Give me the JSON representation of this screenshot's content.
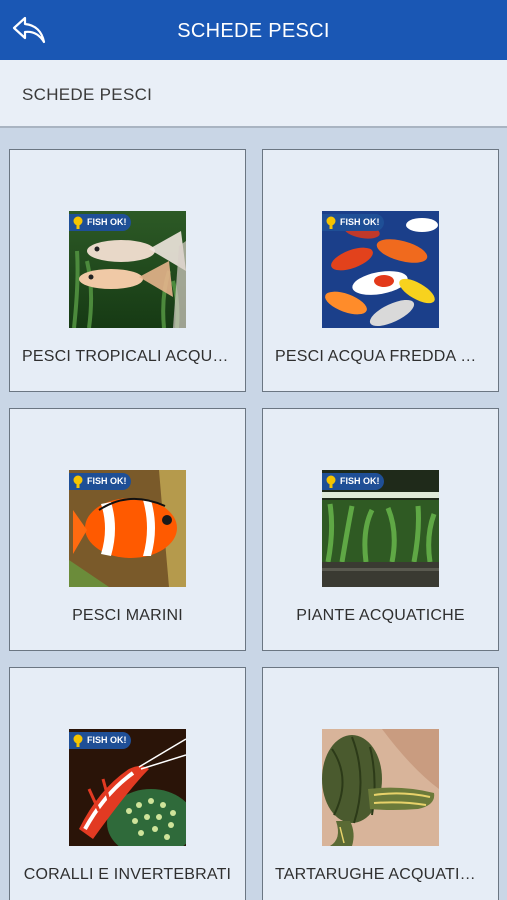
{
  "header": {
    "title": "SCHEDE PESCI",
    "back_icon": "back-arrow-icon",
    "background": "#1a57b4"
  },
  "subheader": {
    "title": "SCHEDE PESCI"
  },
  "badge_text": "FISH OK!",
  "categories": [
    {
      "label": "PESCI TROPICALI ACQUA DOLCE",
      "image": "tropical-fish-photo",
      "badge": true
    },
    {
      "label": "PESCI ACQUA FREDDA E LAGHETTO",
      "image": "koi-carp-photo",
      "badge": true
    },
    {
      "label": "PESCI MARINI",
      "image": "clownfish-photo",
      "badge": true
    },
    {
      "label": "PIANTE ACQUATICHE",
      "image": "planted-aquarium-photo",
      "badge": true
    },
    {
      "label": "CORALLI E INVERTEBRATI",
      "image": "cleaner-shrimp-photo",
      "badge": true
    },
    {
      "label": "TARTARUGHE ACQUATICHE",
      "image": "turtle-photo",
      "badge": false
    }
  ]
}
